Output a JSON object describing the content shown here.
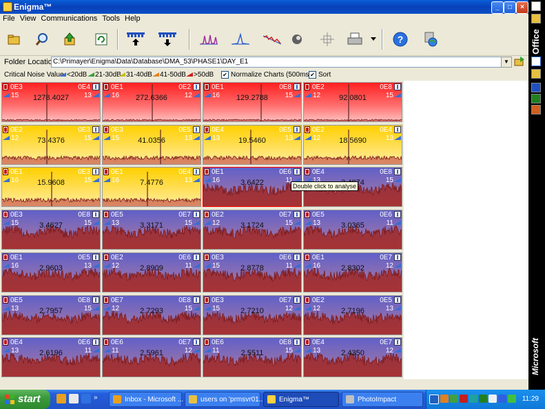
{
  "window": {
    "title": "Enigma™"
  },
  "menu": [
    "File",
    "View",
    "Communications",
    "Tools",
    "Help"
  ],
  "toolbar_icons": [
    "folder-open-icon",
    "magnifier-icon",
    "up-arrow-icon",
    "refresh-icon",
    "upload-channel-icon",
    "download-channel-icon",
    "peak-chart-icon",
    "single-peak-chart-icon",
    "trend-chart-icon",
    "phase-icon",
    "crosshair-icon",
    "printer-icon",
    "dropdown-arrow-icon",
    "help-icon",
    "globe-icon"
  ],
  "folder": {
    "label": "Folder Location",
    "path": "C:\\Primayer\\Enigma\\Data\\Database\\DMA_53\\PHASE1\\DAY_E1"
  },
  "noise": {
    "label": "Critical Noise Value",
    "bands": [
      "<20dB",
      "21-30dB",
      "31-40dB",
      "41-50dB",
      ">50dB"
    ],
    "band_colors": [
      "#3a6ed0",
      "#3aa03a",
      "#c8c020",
      "#e08020",
      "#d02020"
    ],
    "normalize_label": "Normalize Charts (500ms)",
    "normalize_checked": true,
    "sort_label": "Sort",
    "sort_checked": true
  },
  "tooltip": "Double click to analyse",
  "cells": [
    {
      "c": "red",
      "l": "0E3",
      "r": "0E4",
      "dl": "15",
      "dr": "13",
      "v": "1278.4027",
      "spike": 0.45
    },
    {
      "c": "red",
      "l": "0E1",
      "r": "0E2",
      "dl": "16",
      "dr": "12",
      "v": "272.6366",
      "spike": 0.5
    },
    {
      "c": "red",
      "l": "0E1",
      "r": "0E8",
      "dl": "16",
      "dr": "15",
      "v": "129.2788",
      "spike": 0.58
    },
    {
      "c": "red",
      "l": "0E2",
      "r": "0E8",
      "dl": "12",
      "dr": "15",
      "v": "92.0801",
      "spike": 0.45
    },
    {
      "c": "yellow",
      "l": "0E2",
      "r": "0E3",
      "dl": "12",
      "dr": "15",
      "v": "73.4376",
      "spike": 0.45
    },
    {
      "c": "yellow",
      "l": "0E3",
      "r": "0E5",
      "dl": "15",
      "dr": "13",
      "v": "41.0356",
      "spike": 0.58
    },
    {
      "c": "yellow",
      "l": "0E4",
      "r": "0E5",
      "dl": "13",
      "dr": "13",
      "v": "19.5460",
      "spike": 0.48
    },
    {
      "c": "yellow",
      "l": "0E2",
      "r": "0E4",
      "dl": "12",
      "dr": "13",
      "v": "18.5690",
      "spike": 0.45
    },
    {
      "c": "yellow",
      "l": "0E1",
      "r": "0E3",
      "dl": "16",
      "dr": "15",
      "v": "15.9608",
      "spike": 0.5
    },
    {
      "c": "yellow",
      "l": "0E1",
      "r": "0E4",
      "dl": "16",
      "dr": "13",
      "v": "7.4776",
      "spike": 0.45
    },
    {
      "c": "blue",
      "l": "0E1",
      "r": "0E6",
      "dl": "16",
      "dr": "11",
      "v": "3.6422",
      "spike": 0,
      "sel": true
    },
    {
      "c": "blue",
      "l": "0E4",
      "r": "0E8",
      "dl": "13",
      "dr": "15",
      "v": "3.4874",
      "spike": 0
    },
    {
      "c": "blue",
      "l": "0E3",
      "r": "0E8",
      "dl": "15",
      "dr": "15",
      "v": "3.4627",
      "spike": 0
    },
    {
      "c": "blue",
      "l": "0E5",
      "r": "0E7",
      "dl": "13",
      "dr": "15",
      "v": "3.3171",
      "spike": 0
    },
    {
      "c": "blue",
      "l": "0E2",
      "r": "0E7",
      "dl": "12",
      "dr": "15",
      "v": "3.1724",
      "spike": 0
    },
    {
      "c": "blue",
      "l": "0E5",
      "r": "0E6",
      "dl": "13",
      "dr": "11",
      "v": "3.0365",
      "spike": 0
    },
    {
      "c": "blue",
      "l": "0E1",
      "r": "0E5",
      "dl": "16",
      "dr": "13",
      "v": "2.9603",
      "spike": 0
    },
    {
      "c": "blue",
      "l": "0E2",
      "r": "0E6",
      "dl": "12",
      "dr": "11",
      "v": "2.8909",
      "spike": 0
    },
    {
      "c": "blue",
      "l": "0E3",
      "r": "0E6",
      "dl": "15",
      "dr": "11",
      "v": "2.8778",
      "spike": 0
    },
    {
      "c": "blue",
      "l": "0E1",
      "r": "0E7",
      "dl": "16",
      "dr": "12",
      "v": "2.8302",
      "spike": 0
    },
    {
      "c": "blue",
      "l": "0E5",
      "r": "0E8",
      "dl": "13",
      "dr": "15",
      "v": "2.7957",
      "spike": 0
    },
    {
      "c": "blue",
      "l": "0E7",
      "r": "0E8",
      "dl": "12",
      "dr": "15",
      "v": "2.7293",
      "spike": 0
    },
    {
      "c": "blue",
      "l": "0E3",
      "r": "0E7",
      "dl": "15",
      "dr": "12",
      "v": "2.7210",
      "spike": 0
    },
    {
      "c": "blue",
      "l": "0E2",
      "r": "0E5",
      "dl": "12",
      "dr": "13",
      "v": "2.7196",
      "spike": 0
    },
    {
      "c": "blue",
      "l": "0E4",
      "r": "0E6",
      "dl": "13",
      "dr": "11",
      "v": "2.6196",
      "spike": 0
    },
    {
      "c": "blue",
      "l": "0E6",
      "r": "0E7",
      "dl": "11",
      "dr": "12",
      "v": "2.5961",
      "spike": 0
    },
    {
      "c": "blue",
      "l": "0E6",
      "r": "0E8",
      "dl": "11",
      "dr": "15",
      "v": "2.5511",
      "spike": 0
    },
    {
      "c": "blue",
      "l": "0E4",
      "r": "0E7",
      "dl": "13",
      "dr": "12",
      "v": "2.4350",
      "spike": 0
    }
  ],
  "officebar": {
    "top_label": "Office",
    "bottom_label": "Microsoft"
  },
  "taskbar": {
    "start": "start",
    "tasks": [
      "Inbox - Microsoft ...",
      "users on 'prmsvr01...",
      "Enigma™",
      "PhotoImpact"
    ],
    "clock": "11:29"
  }
}
